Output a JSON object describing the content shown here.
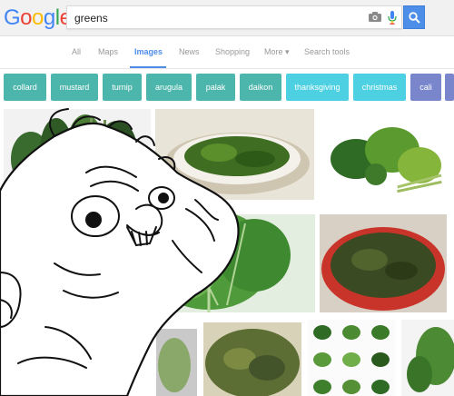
{
  "logo": {
    "letters": [
      "G",
      "o",
      "o",
      "g",
      "l",
      "e"
    ],
    "colors": [
      "#4285f4",
      "#ea4335",
      "#fbbc05",
      "#4285f4",
      "#34a853",
      "#ea4335"
    ]
  },
  "search": {
    "query": "greens",
    "icons": [
      "camera-icon",
      "mic-icon",
      "search-icon"
    ]
  },
  "nav": {
    "tabs": [
      "All",
      "Maps",
      "Images",
      "News",
      "Shopping",
      "More ▾",
      "Search tools"
    ],
    "active": "Images"
  },
  "chips": [
    {
      "label": "collard",
      "color": "#4db6ac"
    },
    {
      "label": "mustard",
      "color": "#4db6ac"
    },
    {
      "label": "turnip",
      "color": "#4db6ac"
    },
    {
      "label": "arugula",
      "color": "#4db6ac"
    },
    {
      "label": "palak",
      "color": "#4db6ac"
    },
    {
      "label": "daikon",
      "color": "#4db6ac"
    },
    {
      "label": "thanksgiving",
      "color": "#4dd0e1"
    },
    {
      "label": "christmas",
      "color": "#4dd0e1"
    },
    {
      "label": "cali",
      "color": "#7986cb"
    }
  ],
  "results": {
    "count": 11,
    "tiles": [
      {
        "name": "result-image-1",
        "kind": "kale-bunch"
      },
      {
        "name": "result-image-2",
        "kind": "greens-bowl"
      },
      {
        "name": "result-image-3",
        "kind": "vegetable-pile"
      },
      {
        "name": "result-image-4",
        "kind": "bok-choy"
      },
      {
        "name": "result-image-5",
        "kind": "cooked-greens-red-pot"
      },
      {
        "name": "result-image-6",
        "kind": "chopped-greens"
      },
      {
        "name": "result-image-7",
        "kind": "leaf-edge"
      },
      {
        "name": "result-image-8",
        "kind": "collard-bowl"
      },
      {
        "name": "result-image-9",
        "kind": "greens-chart"
      },
      {
        "name": "result-image-10",
        "kind": "leaves-right"
      },
      {
        "name": "result-image-11",
        "kind": "kale-small"
      }
    ]
  },
  "overlay": {
    "kind": "hand-drawn rage-comic face sketch"
  },
  "colors": {
    "accent": "#4e8ce8",
    "search_button": "#4d8fe8",
    "header_bg": "#f1f1f1"
  }
}
